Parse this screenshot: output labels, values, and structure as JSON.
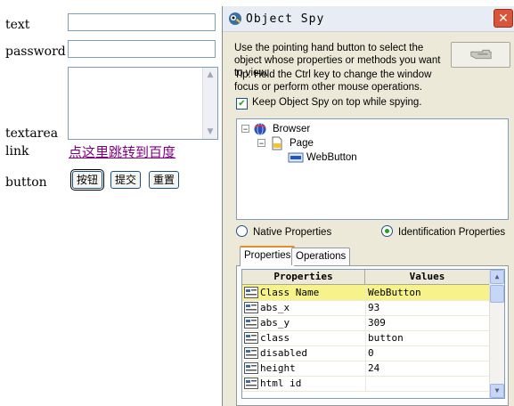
{
  "form": {
    "text_label": "text",
    "password_label": "password",
    "textarea_label": "textarea",
    "link_label": "link",
    "link_text": "点这里跳转到百度",
    "button_label": "button",
    "buttons": [
      "按钮",
      "提交",
      "重置"
    ]
  },
  "spy": {
    "title": "Object Spy",
    "instruction": "Use the pointing hand button to select the object whose properties or methods you want to view.",
    "tip": "Tip: Hold the Ctrl key to change the window focus or perform other mouse operations.",
    "keep_on_top_label": "Keep Object Spy on top while spying.",
    "keep_on_top_checked": true,
    "tree": [
      {
        "label": "Browser",
        "icon": "browser-globe-icon",
        "expander": "−"
      },
      {
        "label": "Page",
        "icon": "page-icon",
        "expander": "−"
      },
      {
        "label": "WebButton",
        "icon": "web-button-icon",
        "selected": true
      }
    ],
    "radio_native": "Native Properties",
    "radio_identification": "Identification Properties",
    "selected_radio": "Identification Properties",
    "tabs": [
      "Properties",
      "Operations"
    ],
    "active_tab": "Properties",
    "grid": {
      "columns": [
        "Properties",
        "Values"
      ],
      "rows": [
        {
          "name": "Class Name",
          "value": "WebButton",
          "selected": true
        },
        {
          "name": "abs_x",
          "value": "93"
        },
        {
          "name": "abs_y",
          "value": "309"
        },
        {
          "name": "class",
          "value": "button"
        },
        {
          "name": "disabled",
          "value": "0"
        },
        {
          "name": "height",
          "value": "24"
        },
        {
          "name": "html id",
          "value": ""
        }
      ]
    }
  },
  "colors": {
    "link": "#800080",
    "selection_row": "#f7f38a",
    "close_button": "#d8553a"
  }
}
